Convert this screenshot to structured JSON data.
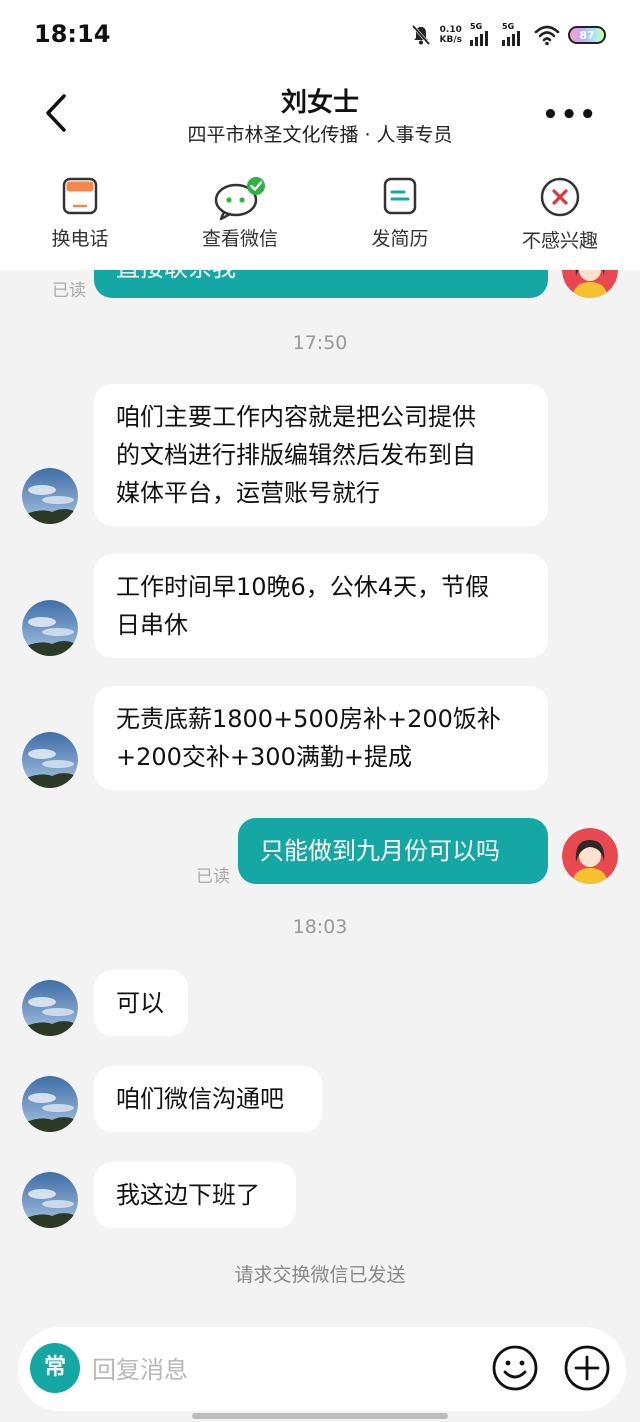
{
  "status_bar": {
    "time": "18:14",
    "net_speed_value": "0.10",
    "net_speed_unit": "KB/s",
    "sim1": "5G",
    "sim2": "5G",
    "battery": "87"
  },
  "header": {
    "title": "刘女士",
    "subtitle": "四平市林圣文化传播 · 人事专员"
  },
  "actions": [
    {
      "label": "换电话",
      "icon": "phone-swap-icon"
    },
    {
      "label": "查看微信",
      "icon": "wechat-icon"
    },
    {
      "label": "发简历",
      "icon": "resume-icon"
    },
    {
      "label": "不感兴趣",
      "icon": "not-interested-icon"
    }
  ],
  "chat": {
    "partial_top_message": "直接联系我",
    "partial_top_read": "已读",
    "time1": "17:50",
    "msg1": [
      "咱们主要工作内容就是把公司提供",
      "的文档进行排版编辑然后发布到自",
      "媒体平台，运营账号就行"
    ],
    "msg2": [
      "工作时间早10晚6，公休4天，节假",
      "日串休"
    ],
    "msg3": [
      "无责底薪1800+500房补+200饭补",
      "+200交补+300满勤+提成"
    ],
    "msg4": "只能做到九月份可以吗",
    "msg4_read": "已读",
    "time2": "18:03",
    "msg5": "可以",
    "msg6": "咱们微信沟通吧",
    "msg7": "我这边下班了",
    "system_notice": "请求交换微信已发送"
  },
  "input": {
    "quick_label": "常",
    "placeholder": "回复消息"
  },
  "colors": {
    "accent": "#15a7a4",
    "badge_green": "#2fb344",
    "reject_red": "#e0333a"
  }
}
